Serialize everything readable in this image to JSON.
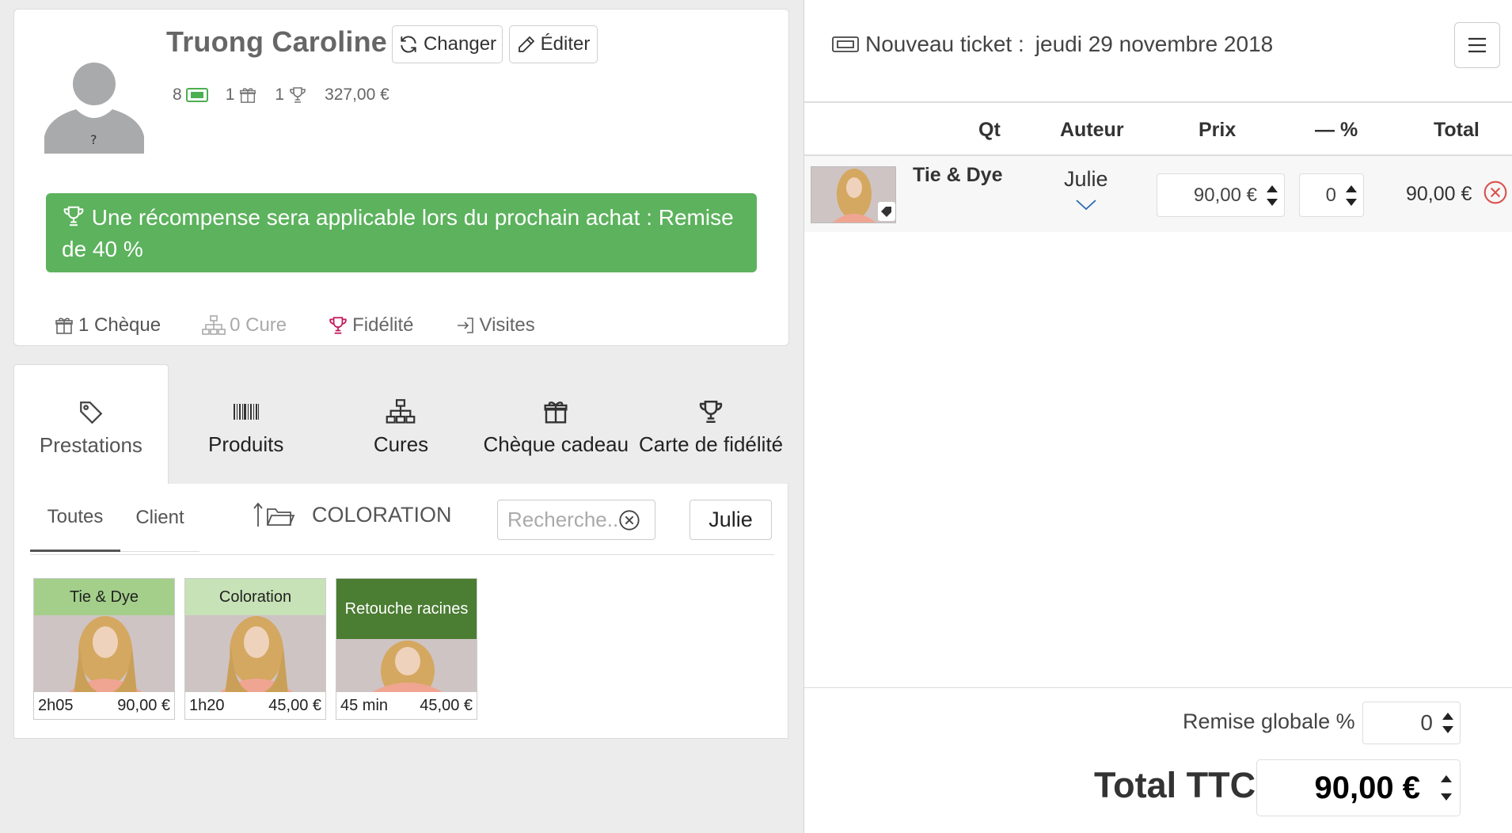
{
  "client": {
    "name": "Truong Caroline",
    "change_label": "Changer",
    "edit_label": "Éditer",
    "stats": {
      "tickets": "8",
      "gifts": "1",
      "loyalty": "1",
      "amount": "327,00 €"
    },
    "reward_message": "Une récompense sera applicable lors du prochain achat : Remise de  40 %",
    "tabs": [
      {
        "label": "1 Chèque"
      },
      {
        "label": "0 Cure"
      },
      {
        "label": "Fidélité"
      },
      {
        "label": "Visites"
      }
    ]
  },
  "categories": [
    {
      "label": "Prestations",
      "icon": "tag-icon"
    },
    {
      "label": "Produits",
      "icon": "barcode-icon"
    },
    {
      "label": "Cures",
      "icon": "sitemap-icon"
    },
    {
      "label": "Chèque cadeau",
      "icon": "gift-icon"
    },
    {
      "label": "Carte de fidélité",
      "icon": "trophy-icon"
    }
  ],
  "catalog": {
    "subtabs": [
      "Toutes",
      "Client"
    ],
    "folder": "COLORATION",
    "search_placeholder": "Recherche...",
    "staff": "Julie",
    "services": [
      {
        "name": "Tie & Dye",
        "duration": "2h05",
        "price": "90,00 €",
        "color": "#a3cf8a"
      },
      {
        "name": "Coloration",
        "duration": "1h20",
        "price": "45,00 €",
        "color": "#c7e2b6"
      },
      {
        "name": "Retouche racines",
        "duration": "45 min",
        "price": "45,00 €",
        "color": "#4b7d33"
      }
    ]
  },
  "ticket": {
    "title": "Nouveau ticket :",
    "date": "jeudi 29 novembre 2018",
    "headers": {
      "qt": "Qt",
      "author": "Auteur",
      "price": "Prix",
      "discount": "— %",
      "total": "Total"
    },
    "lines": [
      {
        "name": "Tie & Dye",
        "author": "Julie",
        "price": "90,00 €",
        "discount": "0",
        "total": "90,00 €"
      }
    ],
    "global_discount_label": "Remise globale %",
    "global_discount": "0",
    "total_label": "Total TTC",
    "total": "90,00 €"
  },
  "colors": {
    "reward_green": "#5cb25d",
    "fidelity_pink": "#c2185b",
    "delete_red": "#d9534f",
    "ticket_green": "#4caf50"
  }
}
